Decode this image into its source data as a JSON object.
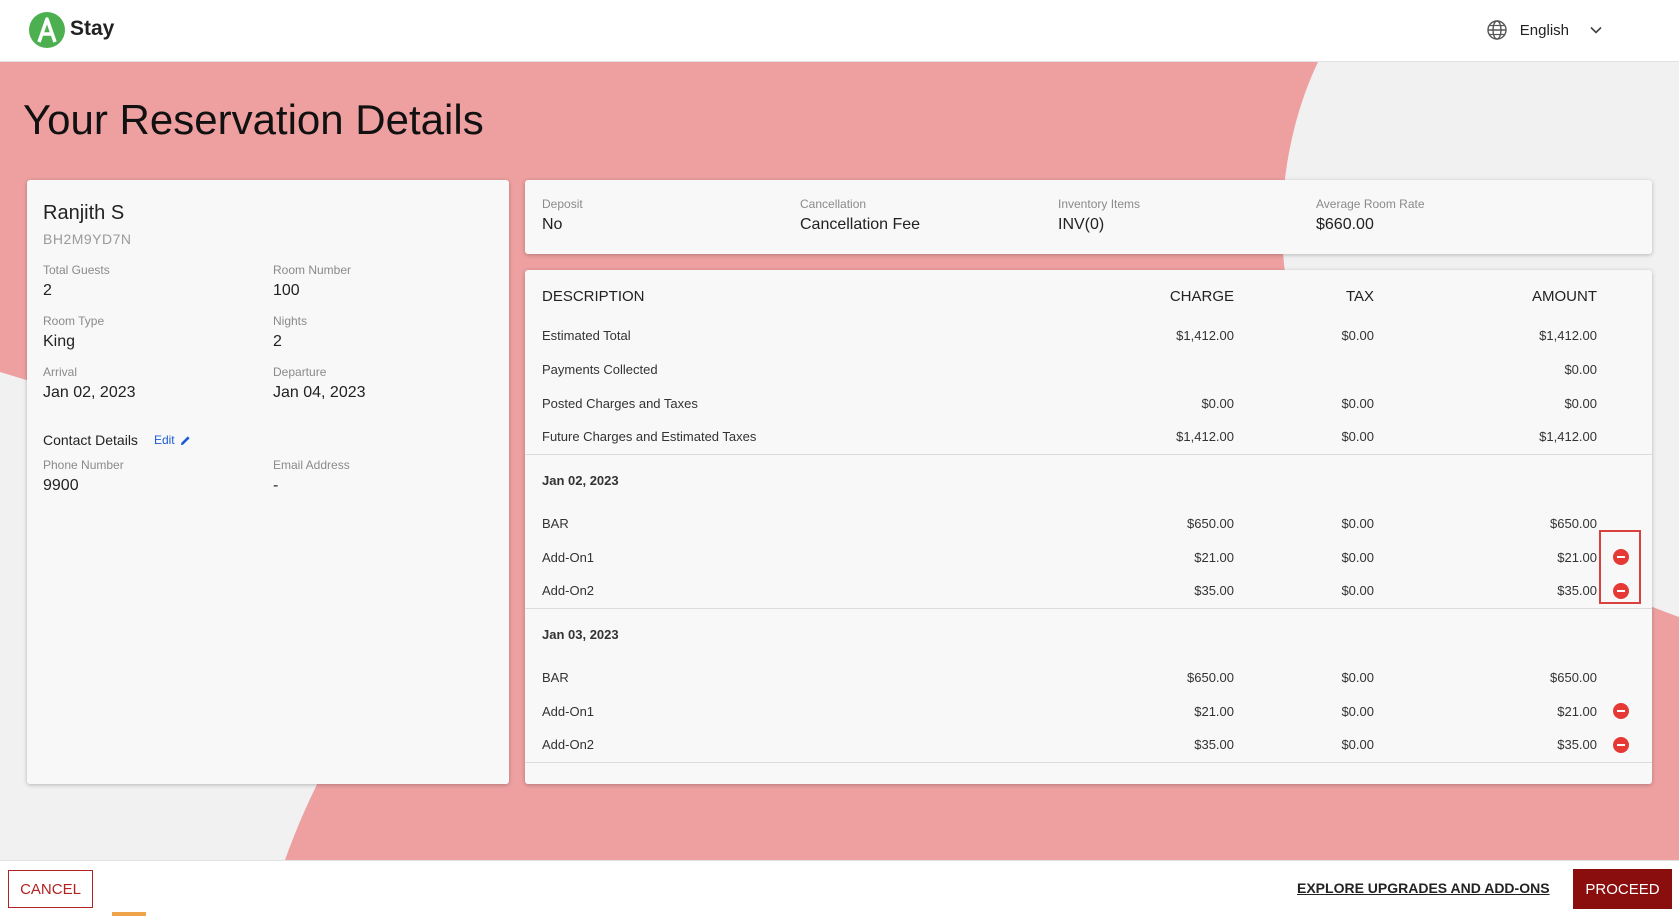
{
  "header": {
    "brand": "Stay",
    "language": "English",
    "icons": [
      "app-logo-icon",
      "globe-icon",
      "chevron-down-icon"
    ]
  },
  "page_title": "Your Reservation Details",
  "guest": {
    "name": "Ranjith S",
    "confirmation": "BH2M9YD7N",
    "fields": [
      {
        "label": "Total Guests",
        "value": "2"
      },
      {
        "label": "Room Number",
        "value": "100"
      },
      {
        "label": "Room Type",
        "value": "King"
      },
      {
        "label": "Nights",
        "value": "2"
      },
      {
        "label": "Arrival",
        "value": "Jan 02, 2023"
      },
      {
        "label": "Departure",
        "value": "Jan 04, 2023"
      }
    ],
    "contact_title": "Contact Details",
    "edit_label": "Edit",
    "contact_fields": [
      {
        "label": "Phone Number",
        "value": "9900"
      },
      {
        "label": "Email Address",
        "value": "-"
      }
    ]
  },
  "summary": [
    {
      "label": "Deposit",
      "value": "No"
    },
    {
      "label": "Cancellation",
      "value": "Cancellation Fee"
    },
    {
      "label": "Inventory Items",
      "value": "INV(0)"
    },
    {
      "label": "Average Room Rate",
      "value": "$660.00"
    }
  ],
  "charges": {
    "headers": {
      "description": "DESCRIPTION",
      "charge": "CHARGE",
      "tax": "TAX",
      "amount": "AMOUNT"
    },
    "totals": [
      {
        "description": "Estimated Total",
        "charge": "$1,412.00",
        "tax": "$0.00",
        "amount": "$1,412.00"
      },
      {
        "description": "Payments Collected",
        "charge": "",
        "tax": "",
        "amount": "$0.00"
      },
      {
        "description": "Posted Charges and Taxes",
        "charge": "$0.00",
        "tax": "$0.00",
        "amount": "$0.00"
      },
      {
        "description": "Future Charges and Estimated Taxes",
        "charge": "$1,412.00",
        "tax": "$0.00",
        "amount": "$1,412.00"
      }
    ],
    "days": [
      {
        "date": "Jan 02, 2023",
        "items": [
          {
            "description": "BAR",
            "charge": "$650.00",
            "tax": "$0.00",
            "amount": "$650.00",
            "removable": false
          },
          {
            "description": "Add-On1",
            "charge": "$21.00",
            "tax": "$0.00",
            "amount": "$21.00",
            "removable": true
          },
          {
            "description": "Add-On2",
            "charge": "$35.00",
            "tax": "$0.00",
            "amount": "$35.00",
            "removable": true
          }
        ]
      },
      {
        "date": "Jan 03, 2023",
        "items": [
          {
            "description": "BAR",
            "charge": "$650.00",
            "tax": "$0.00",
            "amount": "$650.00",
            "removable": false
          },
          {
            "description": "Add-On1",
            "charge": "$21.00",
            "tax": "$0.00",
            "amount": "$21.00",
            "removable": true
          },
          {
            "description": "Add-On2",
            "charge": "$35.00",
            "tax": "$0.00",
            "amount": "$35.00",
            "removable": true
          }
        ]
      }
    ]
  },
  "footer": {
    "cancel_label": "CANCEL",
    "upgrades_label": "EXPLORE UPGRADES AND ADD-ONS",
    "proceed_label": "PROCEED"
  },
  "colors": {
    "accent_pink": "#eea0a0",
    "brand_green": "#4caf50",
    "proceed_bg": "#8b0e0e",
    "cancel_border": "#b22222",
    "remove_icon": "#e53935"
  }
}
